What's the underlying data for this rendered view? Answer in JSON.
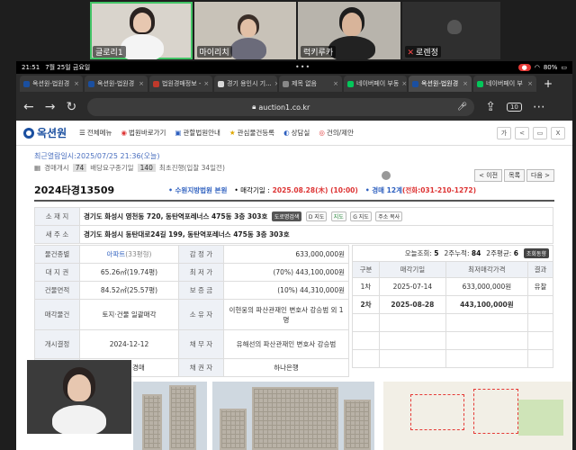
{
  "video_call": {
    "participants": [
      {
        "name": "글로리1",
        "active": true,
        "muted": false
      },
      {
        "name": "마이리치",
        "active": false,
        "muted": false
      },
      {
        "name": "럭키루카",
        "active": false,
        "muted": false
      },
      {
        "name": "로렌정",
        "active": false,
        "muted": true
      }
    ]
  },
  "status_bar": {
    "time": "21:51",
    "date": "7월 25일 금요일",
    "record_label": "●",
    "battery": "80%"
  },
  "tabs": [
    {
      "title": "옥션원-법원경",
      "active": false
    },
    {
      "title": "옥션원-법원경",
      "active": false
    },
    {
      "title": "법원경매정보 -",
      "active": false
    },
    {
      "title": "경기 용인시 기...",
      "active": false
    },
    {
      "title": "제목 없음",
      "active": false
    },
    {
      "title": "네이버페이 부동",
      "active": false
    },
    {
      "title": "옥션원-법원경",
      "active": true
    },
    {
      "title": "네이버페이 부",
      "active": false
    }
  ],
  "address_bar": {
    "url": "auction1.co.kr",
    "tab_count": "10"
  },
  "site": {
    "logo": "옥션원",
    "nav": [
      "전체메뉴",
      "법원바로가기",
      "관할법원안내",
      "관심물건등록",
      "상담실",
      "건의/제안"
    ],
    "header_buttons": [
      "가",
      "<",
      "▭",
      "X"
    ]
  },
  "recent_view": "최근열람일시:2025/07/25 21:36(오늘)",
  "sub_info": {
    "label1": "경매개시",
    "count1": "74",
    "label2": "배당요구종기일",
    "count2": "140",
    "label3": "최초진행(입찰 34일전)"
  },
  "page_nav": {
    "prev": "< 이전",
    "list": "목록",
    "next": "다음 >"
  },
  "case": {
    "number": "2024타경13509",
    "court": "• 수원지방법원 본원",
    "sale_date_label": "• 매각기일 :",
    "sale_date": "2025.08.28(木) (10:00)",
    "division": "• 경매 12계",
    "phone": "(전화:031-210-1272)"
  },
  "info": {
    "address_label": "소 재 지",
    "address": "경기도 화성시 영천동 720, 동탄역포레너스 475동 3층 303호",
    "address_buttons": [
      "도로명검색",
      "D 지도",
      "지도",
      "G 지도",
      "주소 복사"
    ],
    "new_address_label": "새 주 소",
    "new_address": "경기도 화성시 동탄대로24길 199, 동탄역포레너스 475동 3층 303호",
    "rows": [
      {
        "l1": "물건종별",
        "v1": "아파트",
        "v1b": "(33평형)",
        "l2": "감 정 가",
        "v2": "633,000,000원"
      },
      {
        "l1": "대 지 권",
        "v1": "65.26㎡(19.74평)",
        "l2": "최 저 가",
        "v2": "(70%) 443,100,000원"
      },
      {
        "l1": "건물면적",
        "v1": "84.52㎡(25.57평)",
        "l2": "보 증 금",
        "v2": "(10%) 44,310,000원"
      },
      {
        "l1": "매각물건",
        "v1": "토지·건물 일괄매각",
        "l2": "소 유 자",
        "v2": "이현웅의 파산관재인 변호사 강승범 외 1명"
      },
      {
        "l1": "개시결정",
        "v1": "2024-12-12",
        "l2": "채 무 자",
        "v2": "유해선의 파산관재인 변호사 강승범"
      },
      {
        "l1": "",
        "v1": "신임의경매",
        "l2": "채 권 자",
        "v2": "하나은행"
      }
    ]
  },
  "history": {
    "views_today_label": "오늘조회:",
    "views_today": "5",
    "views_2w_label": "2주누적:",
    "views_2w": "84",
    "avg_2w_label": "2주평균:",
    "avg_2w": "6",
    "trend_button": "조회동향",
    "headers": [
      "구분",
      "매각기일",
      "최저매각가격",
      "결과"
    ],
    "rows": [
      {
        "round": "1차",
        "date": "2025-07-14",
        "price": "633,000,000원",
        "result": "유찰"
      },
      {
        "round": "2차",
        "date": "2025-08-28",
        "price": "443,100,000원",
        "result": ""
      }
    ]
  },
  "colors": {
    "accent": "#2d5fbf",
    "logo": "#1a4fa0",
    "danger": "#d33"
  }
}
